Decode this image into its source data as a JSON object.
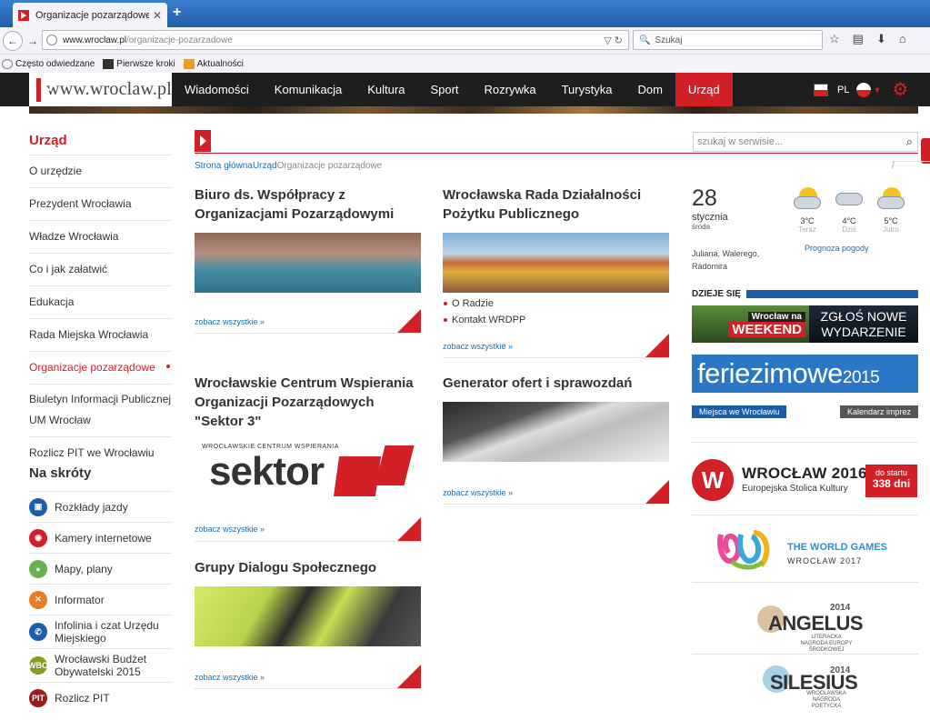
{
  "browser": {
    "tab_title": "Organizacje pozarządowe | w...",
    "url_host": "www.wroclaw.pl",
    "url_path": "/organizacje-pozarzadowe",
    "search_placeholder": "Szukaj",
    "bookmarks": [
      "Często odwiedzane",
      "Pierwsze kroki",
      "Aktualności"
    ]
  },
  "site": {
    "logo_text": "www.wroclaw.pl",
    "menu": [
      "Wiadomości",
      "Komunikacja",
      "Kultura",
      "Sport",
      "Rozrywka",
      "Turystyka",
      "Dom",
      "Urząd"
    ],
    "active_menu": "Urząd",
    "lang": "PL",
    "search_placeholder": "szukaj w serwisie..."
  },
  "breadcrumb": [
    "Strona główna",
    "Urząd",
    "Organizacje pozarządowe"
  ],
  "sidebar": {
    "heading": "Urząd",
    "items": [
      "O urzędzie",
      "Prezydent Wrocławia",
      "Władze Wrocławia",
      "Co i jak załatwić",
      "Edukacja",
      "Rada Miejska Wrocławia",
      "Organizacje pozarządowe",
      "Biuletyn Informacji Publicznej UM Wrocław",
      "Rozlicz PIT we Wrocławiu"
    ],
    "active_index": 6,
    "shortcuts_heading": "Na skróty",
    "shortcuts": [
      {
        "label": "Rozkłady jazdy",
        "color": "#1e5ea8",
        "icon": "bus-icon"
      },
      {
        "label": "Kamery internetowe",
        "color": "#d31f26",
        "icon": "camera-icon"
      },
      {
        "label": "Mapy, plany",
        "color": "#6ab04c",
        "icon": "map-pin-icon"
      },
      {
        "label": "Informator",
        "color": "#e67e22",
        "icon": "info-icon"
      },
      {
        "label": "Infolinia i czat Urzędu Miejskiego",
        "color": "#1e5ea8",
        "icon": "phone-icon"
      },
      {
        "label": "Wrocławski Budżet Obywatelski 2015",
        "color": "#8a9a1a",
        "icon": "wbo-icon",
        "badge": "WBO"
      },
      {
        "label": "Rozlicz PIT",
        "color": "#9b1b1b",
        "icon": "pit-icon",
        "badge": "PIT"
      }
    ]
  },
  "cards": {
    "c1": {
      "title": "Biuro ds. Współpracy z Organizacjami Pozarządowymi",
      "more": "zobacz wszystkie »"
    },
    "c2": {
      "title": "Wrocławska Rada Działalności Pożytku Publicznego",
      "more": "zobacz wszystkie »",
      "links": [
        "O Radzie",
        "Kontakt WRDPP"
      ]
    },
    "c3": {
      "title": "Wrocławskie Centrum Wspierania Organizacji Pozarządowych \"Sektor 3\"",
      "more": "zobacz wszystkie »",
      "img_top": "WROCŁAWSKIE CENTRUM WSPIERANIA",
      "img_word": "sektor"
    },
    "c4": {
      "title": "Generator ofert i sprawozdań",
      "more": "zobacz wszystkie »"
    },
    "c5": {
      "title": "Grupy Dialogu Społecznego",
      "more": "zobacz wszystkie »"
    }
  },
  "weather": {
    "day": "28",
    "month": "stycznia",
    "weekday": "środa",
    "names": "Juliana, Walerego, Radomira",
    "forecast": [
      {
        "temp": "3°C",
        "label": "Teraz"
      },
      {
        "temp": "4°C",
        "label": "Dziś"
      },
      {
        "temp": "5°C",
        "label": "Jutro"
      }
    ],
    "link": "Prognoza pogody"
  },
  "right": {
    "dzieje": "DZIEJE SIĘ",
    "weekend_1": "Wrocław na",
    "weekend_2": "WEEKEND",
    "zglos": "ZGŁOŚ NOWE WYDARZENIE",
    "ferie_word": "feriezimowe",
    "ferie_year": "2015",
    "tag_left": "Miejsca we Wrocławiu",
    "tag_right": "Kalendarz imprez",
    "ecoc_title": "WROCŁAW 2016",
    "ecoc_sub": "Europejska Stolica Kultury",
    "ecoc_days_label": "do startu",
    "ecoc_days": "338 dni",
    "twg_1": "THE WORLD GAMES",
    "twg_2": "WROCŁAW 2017",
    "angelus": "ANGELUS",
    "angelus_year": "2014",
    "angelus_sub": "LITERACKA NAGRODA EUROPY ŚRODKOWEJ",
    "silesius": "SILESIUS",
    "silesius_year": "2014",
    "silesius_sub": "WROCŁAWSKA NAGRODA POETYCKA"
  }
}
